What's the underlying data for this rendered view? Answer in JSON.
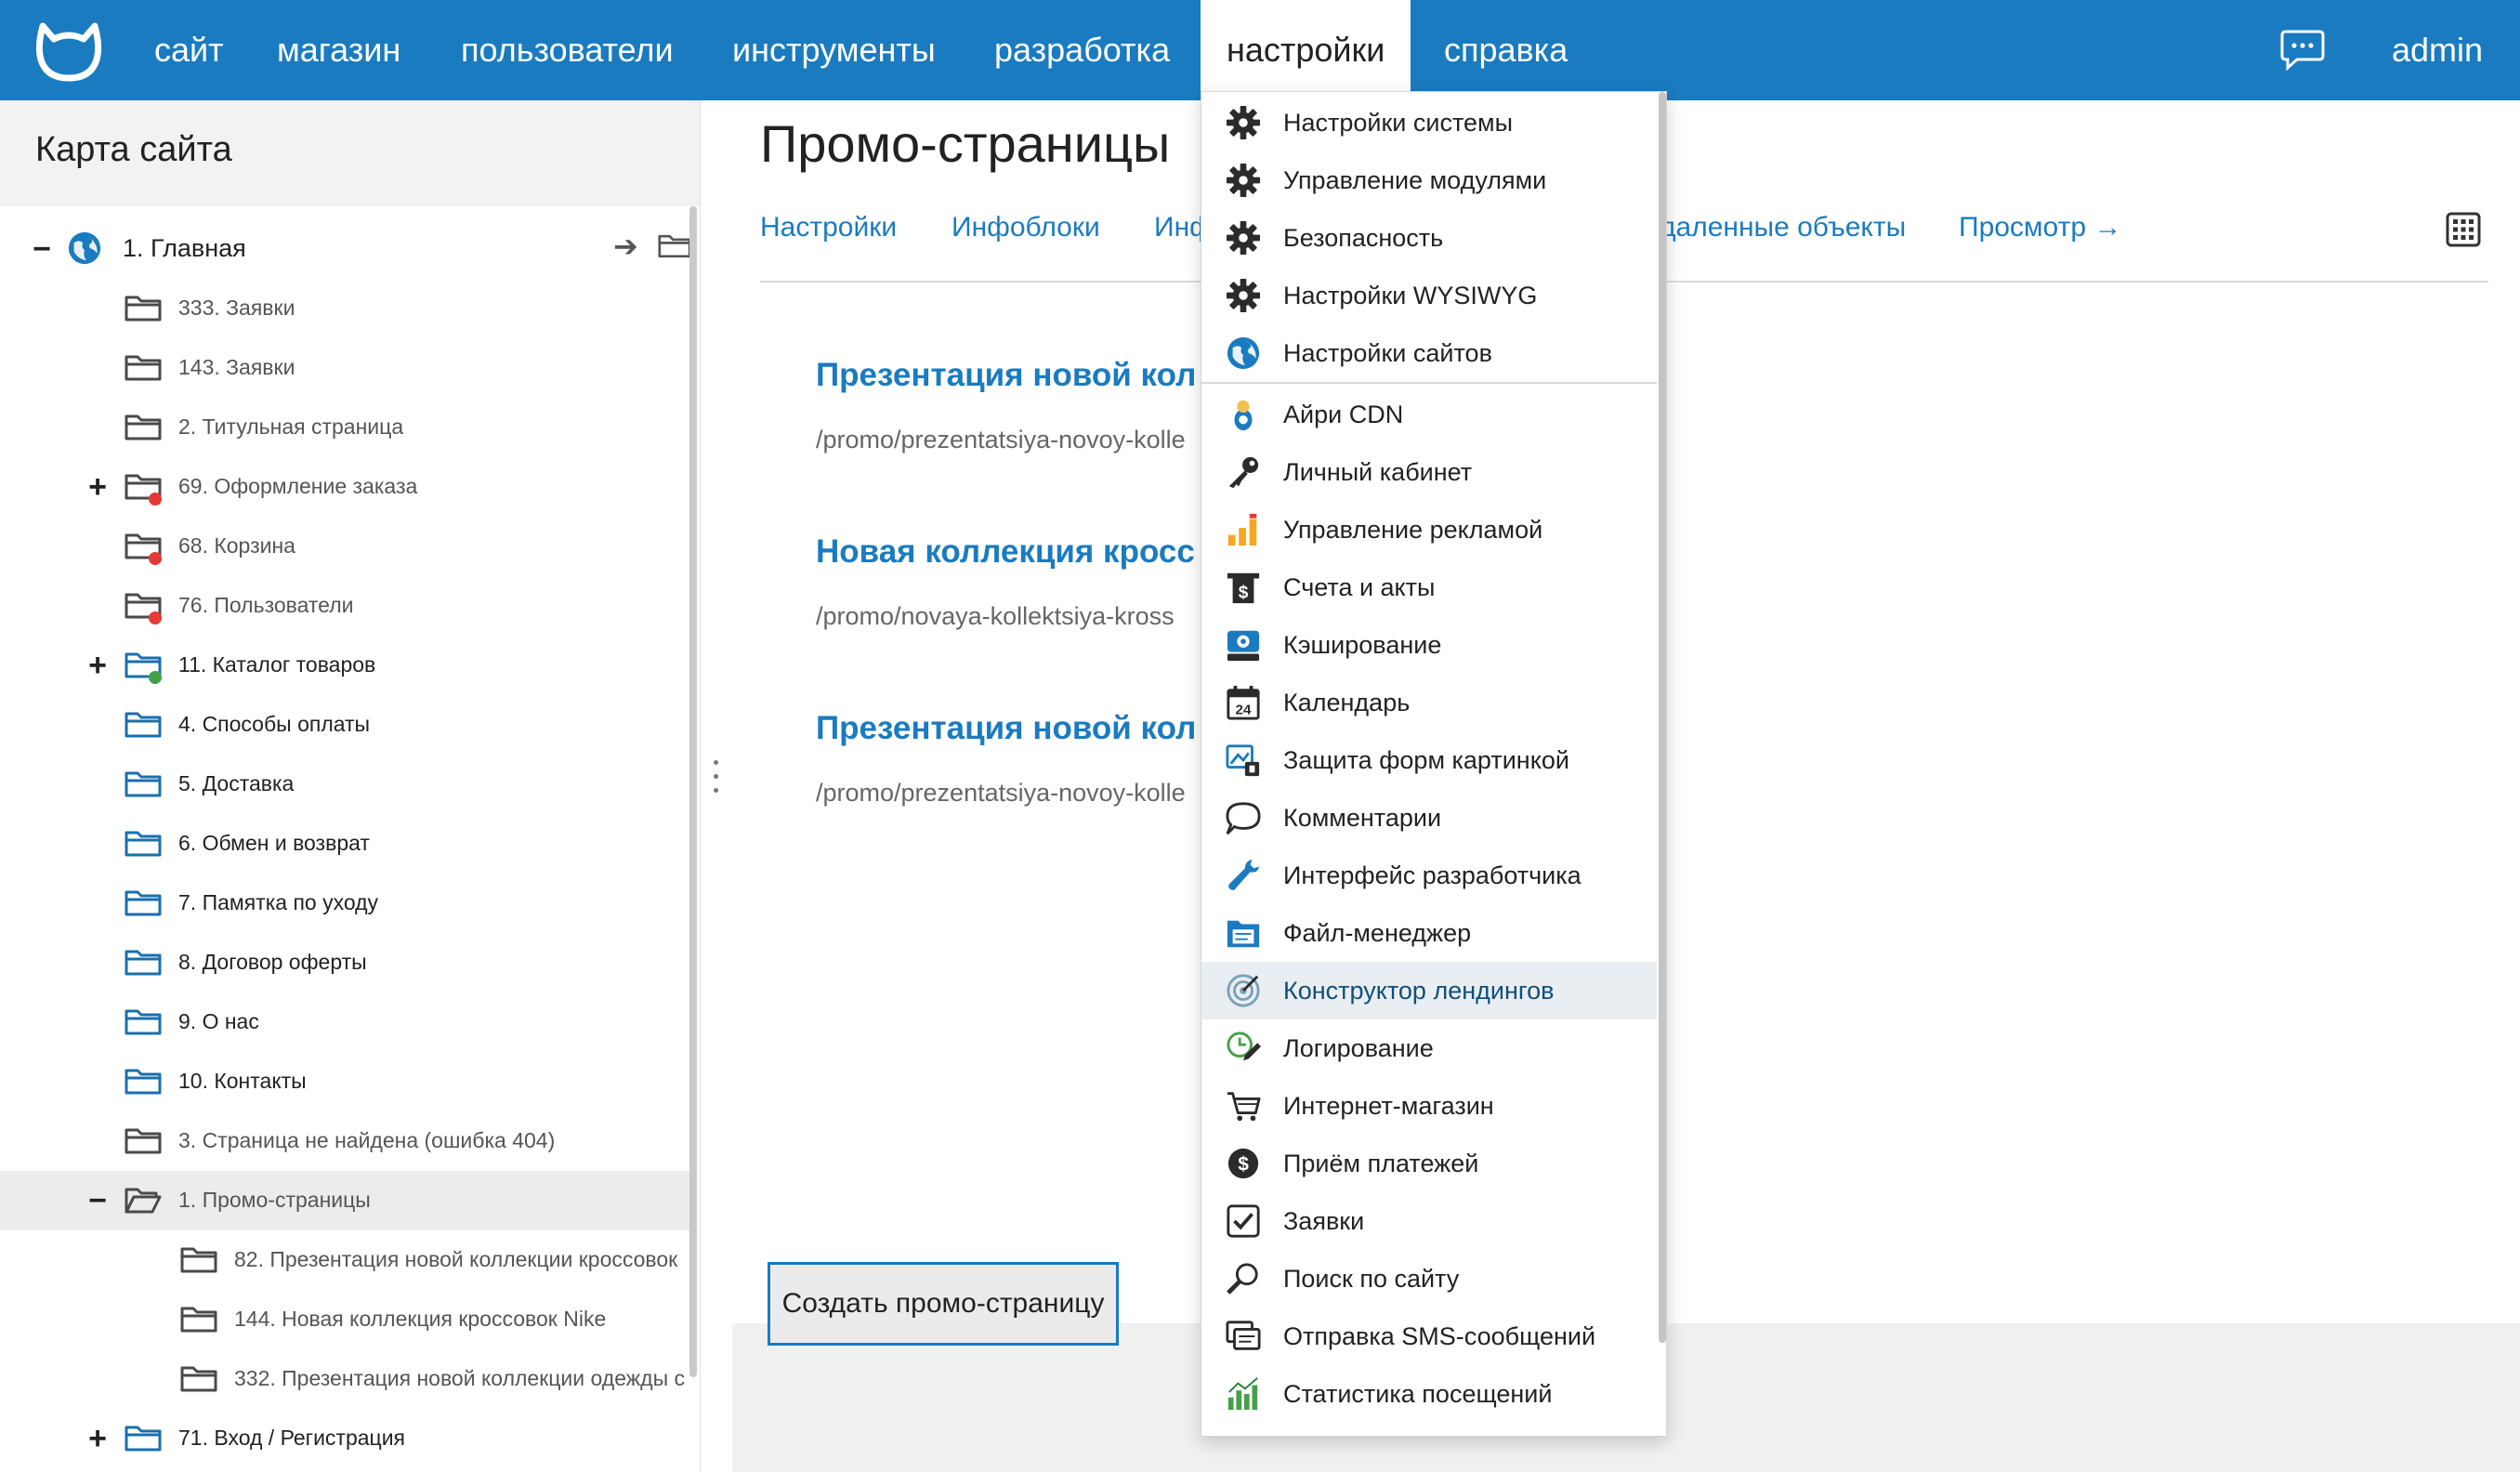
{
  "nav": {
    "items": [
      "сайт",
      "магазин",
      "пользователи",
      "инструменты",
      "разработка",
      "настройки",
      "справка"
    ],
    "active_index": 5,
    "user": "admin"
  },
  "sidebar": {
    "title": "Карта сайта",
    "tree": [
      {
        "label": "1. Главная",
        "toggle": "−",
        "status": ""
      },
      {
        "label": "333. Заявки",
        "toggle": "",
        "status": ""
      },
      {
        "label": "143. Заявки",
        "toggle": "",
        "status": ""
      },
      {
        "label": "2. Титульная страница",
        "toggle": "",
        "status": ""
      },
      {
        "label": "69. Оформление заказа",
        "toggle": "+",
        "status": "red"
      },
      {
        "label": "68. Корзина",
        "toggle": "",
        "status": "red"
      },
      {
        "label": "76. Пользователи",
        "toggle": "",
        "status": "red"
      },
      {
        "label": "11. Каталог товаров",
        "toggle": "+",
        "status": "green"
      },
      {
        "label": "4. Способы оплаты",
        "toggle": "",
        "status": ""
      },
      {
        "label": "5. Доставка",
        "toggle": "",
        "status": ""
      },
      {
        "label": "6. Обмен и возврат",
        "toggle": "",
        "status": ""
      },
      {
        "label": "7. Памятка по уходу",
        "toggle": "",
        "status": ""
      },
      {
        "label": "8. Договор оферты",
        "toggle": "",
        "status": ""
      },
      {
        "label": "9. О нас",
        "toggle": "",
        "status": ""
      },
      {
        "label": "10. Контакты",
        "toggle": "",
        "status": ""
      },
      {
        "label": "3. Страница не найдена (ошибка 404)",
        "toggle": "",
        "status": ""
      },
      {
        "label": "1. Промо-страницы",
        "toggle": "−",
        "status": ""
      },
      {
        "label": "82. Презентация новой коллекции кроссовок",
        "toggle": "",
        "status": ""
      },
      {
        "label": "144. Новая коллекция кроссовок Nike",
        "toggle": "",
        "status": ""
      },
      {
        "label": "332. Презентация новой коллекции одежды с",
        "toggle": "",
        "status": ""
      },
      {
        "label": "71. Вход / Регистрация",
        "toggle": "+",
        "status": ""
      }
    ]
  },
  "main": {
    "title": "Промо-страницы",
    "tabs": [
      "Настройки",
      "Инфоблоки",
      "Инф",
      "даленные объекты",
      "Просмотр →"
    ],
    "items": [
      {
        "title": "Презентация новой кол",
        "url": "/promo/prezentatsiya-novoy-kolle"
      },
      {
        "title": "Новая коллекция кросс",
        "url": "/promo/novaya-kollektsiya-kross"
      },
      {
        "title": "Презентация новой кол",
        "url": "/promo/prezentatsiya-novoy-kolle"
      }
    ],
    "create_button": "Создать промо-страницу"
  },
  "dropdown": {
    "items": [
      {
        "label": "Настройки системы",
        "icon": "gear-icon"
      },
      {
        "label": "Управление модулями",
        "icon": "gear-icon"
      },
      {
        "label": "Безопасность",
        "icon": "gear-icon"
      },
      {
        "label": "Настройки WYSIWYG",
        "icon": "gear-icon"
      },
      {
        "label": "Настройки сайтов",
        "icon": "globe-icon"
      },
      {
        "label": "Айри CDN",
        "icon": "cdn-icon"
      },
      {
        "label": "Личный кабинет",
        "icon": "key-icon"
      },
      {
        "label": "Управление рекламой",
        "icon": "bar-chart-icon"
      },
      {
        "label": "Счета и акты",
        "icon": "invoice-icon"
      },
      {
        "label": "Кэширование",
        "icon": "cache-icon"
      },
      {
        "label": "Календарь",
        "icon": "calendar-icon"
      },
      {
        "label": "Защита форм картинкой",
        "icon": "captcha-icon"
      },
      {
        "label": "Комментарии",
        "icon": "comment-icon"
      },
      {
        "label": "Интерфейс разработчика",
        "icon": "wrench-icon"
      },
      {
        "label": "Файл-менеджер",
        "icon": "file-manager-icon"
      },
      {
        "label": "Конструктор лендингов",
        "icon": "target-icon"
      },
      {
        "label": "Логирование",
        "icon": "log-icon"
      },
      {
        "label": "Интернет-магазин",
        "icon": "cart-icon"
      },
      {
        "label": "Приём платежей",
        "icon": "payment-icon"
      },
      {
        "label": "Заявки",
        "icon": "checkbox-icon"
      },
      {
        "label": "Поиск по сайту",
        "icon": "search-icon"
      },
      {
        "label": "Отправка SMS-сообщений",
        "icon": "sms-icon"
      },
      {
        "label": "Статистика посещений",
        "icon": "stats-icon"
      }
    ],
    "calendar_day": "24",
    "hover_index": 15
  },
  "colors": {
    "brand": "#1a7bc0",
    "status_red": "#e53935",
    "status_green": "#43a047",
    "gear": "#2b2b2b",
    "globe": "#1a7bc0"
  }
}
